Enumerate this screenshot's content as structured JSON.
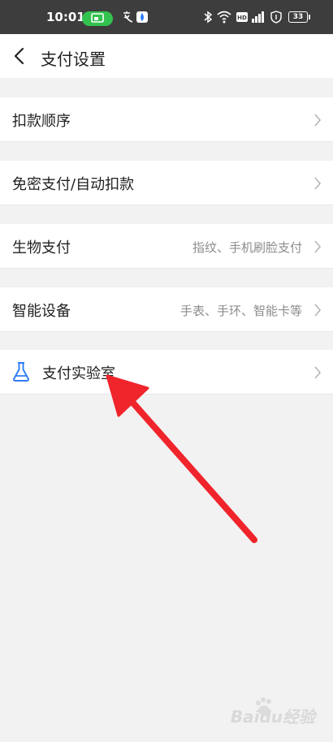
{
  "status_bar": {
    "time": "10:01",
    "battery": "33",
    "icons": [
      "cast-icon",
      "translate-icon",
      "app-icon",
      "bluetooth-icon",
      "wifi-icon",
      "hd-icon",
      "signal-icon",
      "shield-icon",
      "battery-icon"
    ]
  },
  "nav": {
    "title": "支付设置",
    "back_icon": "chevron-left-icon"
  },
  "menu": {
    "debit_order": {
      "label": "扣款顺序"
    },
    "password_free": {
      "label": "免密支付/自动扣款"
    },
    "biometric": {
      "label": "生物支付",
      "detail": "指纹、手机刷脸支付"
    },
    "smart_devices": {
      "label": "智能设备",
      "detail": "手表、手环、智能卡等"
    },
    "payment_lab": {
      "label": "支付实验室",
      "icon": "flask-icon"
    }
  },
  "annotation": {
    "color": "#f0242b",
    "icon": "arrow-icon"
  },
  "watermark": {
    "text": "Baidu经验"
  },
  "colors": {
    "accent": "#2f7cf6",
    "status_green": "#33c24f",
    "background": "#f2f2f2"
  }
}
